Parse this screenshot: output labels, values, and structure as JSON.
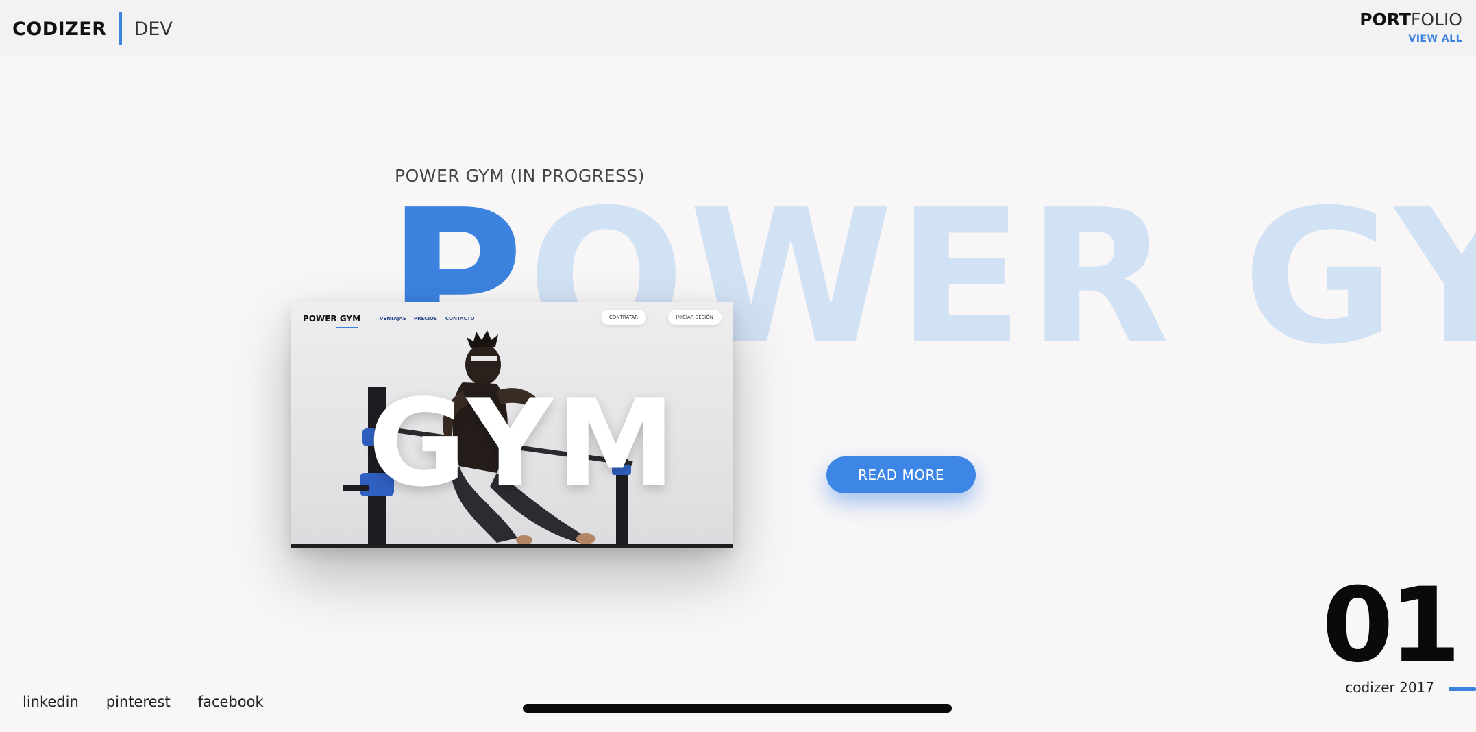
{
  "header": {
    "brand_name": "CODIZER",
    "brand_sub": "DEV",
    "portfolio_strong": "PORT",
    "portfolio_light": "FOLIO",
    "view_all": "VIEW ALL"
  },
  "project": {
    "label": "POWER GYM (IN PROGRESS)",
    "giant_first": "P",
    "giant_rest": "OWER GYM",
    "read_more": "READ MORE"
  },
  "mockup": {
    "logo": "POWER GYM",
    "links": [
      "VENTAJAS",
      "PRECIOS",
      "CONTACTO"
    ],
    "buttons": [
      "CONTRATAR",
      "INICIAR SESIÓN"
    ],
    "hero_word": "GYM"
  },
  "footer": {
    "socials": [
      "linkedin",
      "pinterest",
      "facebook"
    ],
    "slide_number": "01",
    "caption": "codizer 2017"
  },
  "colors": {
    "accent": "#3c83df",
    "giant_text": "#d2e2f5",
    "background": "#f8f6f7"
  }
}
